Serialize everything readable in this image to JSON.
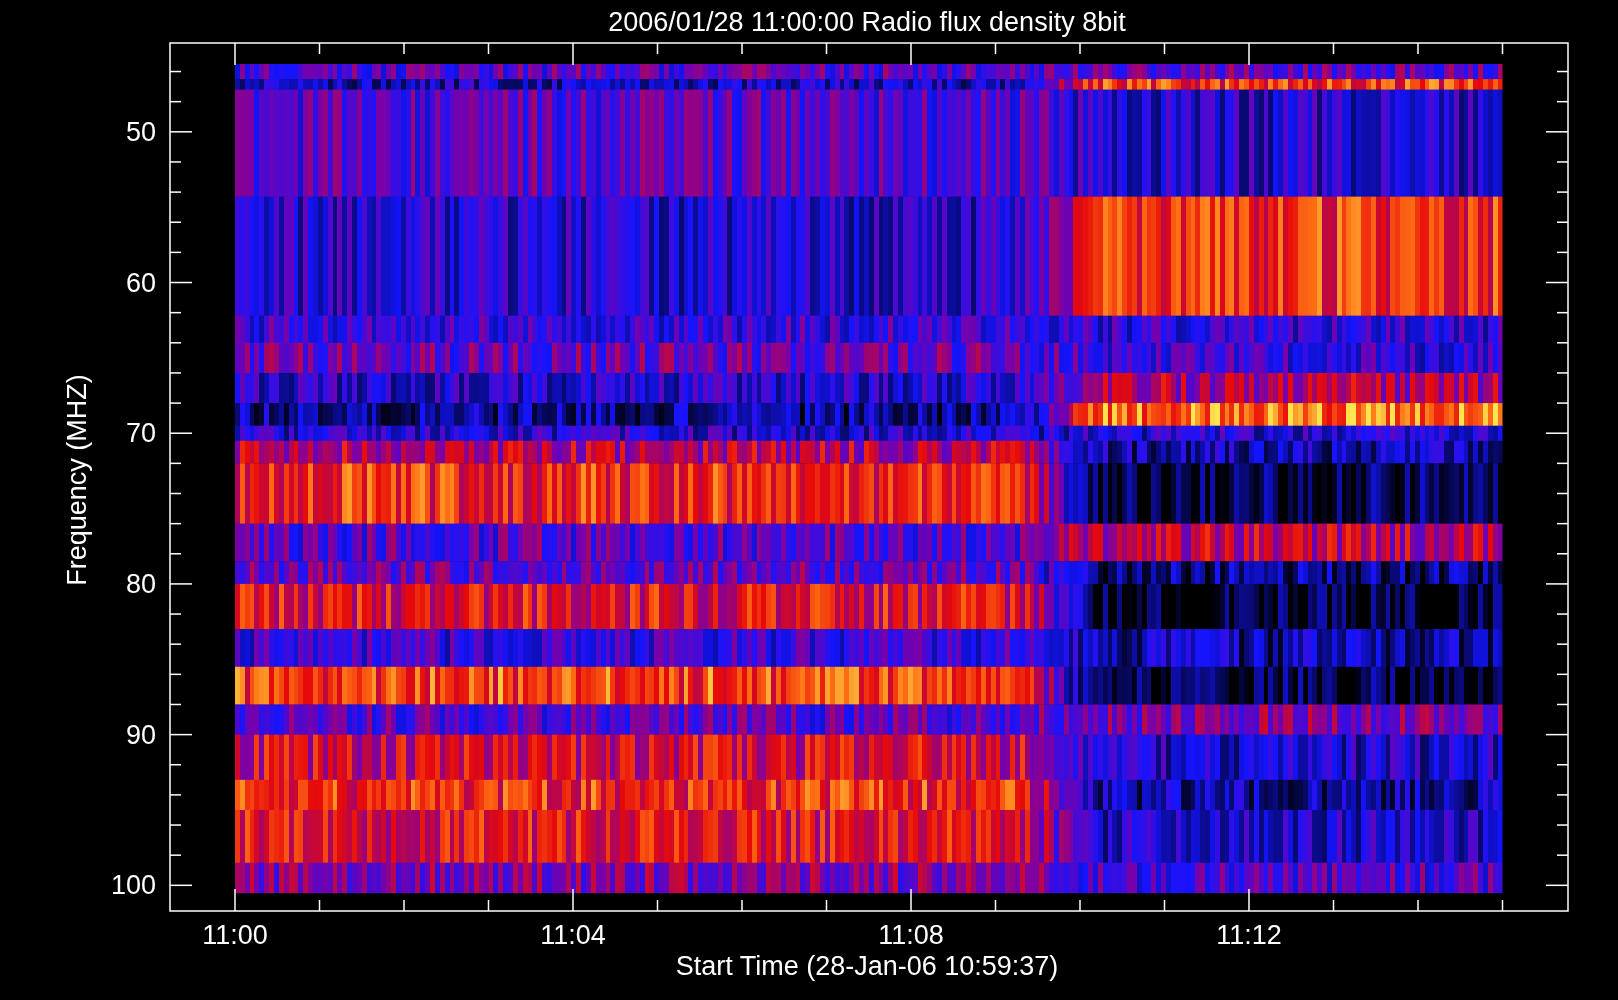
{
  "title": "2006/01/28 11:00:00 Radio flux density 8bit",
  "y_axis": {
    "label": "Frequency (MHZ)",
    "ticks": [
      "50",
      "60",
      "70",
      "80",
      "90",
      "100"
    ]
  },
  "x_axis": {
    "label": "Start Time (28-Jan-06 10:59:37)",
    "ticks": [
      "11:00",
      "11:04",
      "11:08",
      "11:12"
    ]
  }
}
